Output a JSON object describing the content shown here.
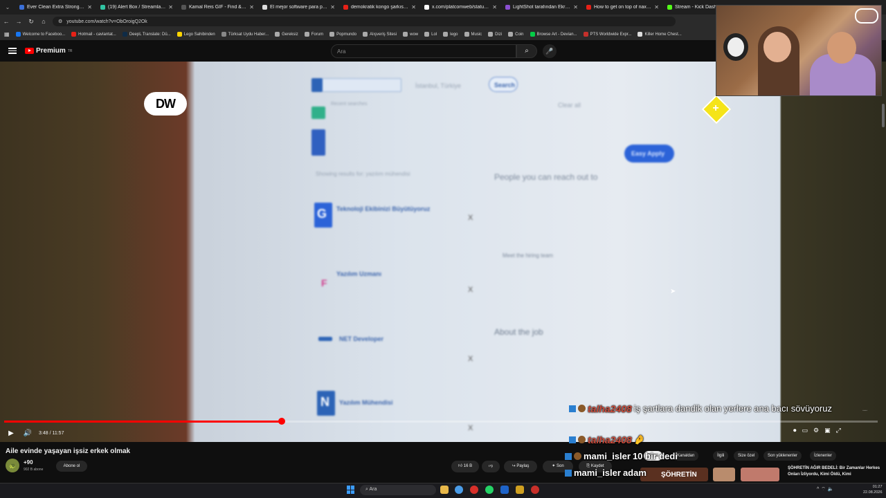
{
  "browser": {
    "tabs": [
      {
        "title": "Ever Clean Extra Strong Koku...",
        "color": "#3a6fd8"
      },
      {
        "title": "(19) Alert Box / Streamlabs",
        "color": "#31c3a2"
      },
      {
        "title": "Kamal Reis GIF - Find & Share...",
        "color": "#555555"
      },
      {
        "title": "El mejor software para poten...",
        "color": "#dddddd"
      },
      {
        "title": "demokratik kongo şarkısı - ki...",
        "color": "#e62117"
      },
      {
        "title": "x.com/platcomweb/status/20...",
        "color": "#ffffff"
      },
      {
        "title": "LightShot tarafından Ekran Gö...",
        "color": "#8a4fd0"
      },
      {
        "title": "How to get on top of naxxra...",
        "color": "#e62117"
      },
      {
        "title": "Stream - Kick Dashboard",
        "color": "#53fc18"
      }
    ],
    "url": "youtube.com/watch?v=ObOroigQ2Ok",
    "bookmarks": [
      {
        "label": "Welcome to Faceboo...",
        "color": "#1877f2"
      },
      {
        "label": "Hotmail - cavlantat...",
        "color": "#e62117"
      },
      {
        "label": "DeepL Translate: Dü...",
        "color": "#0f2b46"
      },
      {
        "label": "Lego Sahibinden",
        "color": "#ffd500"
      },
      {
        "label": "Türksat Uydu Haber...",
        "color": "#888888"
      },
      {
        "label": "Gereksiz",
        "color": "#aaaaaa"
      },
      {
        "label": "Forum",
        "color": "#aaaaaa"
      },
      {
        "label": "Popmundo",
        "color": "#aaaaaa"
      },
      {
        "label": "Alışveriş Sitesi",
        "color": "#aaaaaa"
      },
      {
        "label": "wow",
        "color": "#aaaaaa"
      },
      {
        "label": "Lol",
        "color": "#aaaaaa"
      },
      {
        "label": "lego",
        "color": "#aaaaaa"
      },
      {
        "label": "Music",
        "color": "#aaaaaa"
      },
      {
        "label": "Dizi",
        "color": "#aaaaaa"
      },
      {
        "label": "Coin",
        "color": "#aaaaaa"
      },
      {
        "label": "Browse Art - Devian...",
        "color": "#05cc47"
      },
      {
        "label": "PTS Worldwide Expr...",
        "color": "#c4302b"
      },
      {
        "label": "Killer Home Chest...",
        "color": "#dddddd"
      }
    ]
  },
  "youtube": {
    "logo_text": "Premium",
    "logo_region": "TR",
    "search_placeholder": "Ara",
    "video": {
      "channel_badge": "DW",
      "time": "3:48 / 11:57",
      "progress": 0.318,
      "screen_content": {
        "search_button": "Search",
        "location": "İstanbul, Türkiye",
        "recent_searches": "Recent searches",
        "jobs": [
          {
            "title": "Teknoloji Ekibinizi Büyütüyoruz",
            "letter": "G"
          },
          {
            "title": "Yazılım Uzmanı",
            "letter": "F"
          },
          {
            "title": "NET Developer",
            "letter": ""
          },
          {
            "title": "Yazılım Mühendisi",
            "letter": "N"
          }
        ],
        "people_heading": "People you can reach out to",
        "meet_team": "Meet the hiring team",
        "about_job": "About the job",
        "easy_apply": "Easy Apply",
        "clear_all": "Clear all",
        "results_for": "Showing results for: yazılım mühendisi"
      }
    },
    "title": "Aile evinde yaşayan işsiz erkek olmak",
    "channel_name": "+90",
    "subscribers": "902 B abone",
    "subscribe_label": "Abone ol",
    "likes": "16 B",
    "share_label": "Paylaş",
    "save_label": "Kaydet",
    "more_label": "Son",
    "chips": [
      "Tümü",
      "Kanaldan",
      "İlgili",
      "Size özel",
      "Son yüklenenler",
      "İzlenenler"
    ],
    "recommended_title": "ŞÖHRETİN AĞIR BEDELİ: Bir Zamanlar Herkes Onları İzliyordu, Kimi Öldü, Kimi",
    "recommended_thumb_text": "ŞÖHRETİN"
  },
  "chat": [
    {
      "user": "talha2408",
      "message": "iş şartlara dandik olan yerlere ana bacı sövüyoruz",
      "style": "red"
    },
    {
      "user": "talha2408",
      "message": "🤌",
      "style": "red"
    },
    {
      "user": "mami_isler",
      "message": "10 bir dedi",
      "style": "white"
    },
    {
      "user": "mami_isler",
      "message": "adam",
      "style": "white"
    }
  ],
  "taskbar": {
    "search_placeholder": "Ara",
    "time": "01:27",
    "date": "22.08.2026"
  }
}
